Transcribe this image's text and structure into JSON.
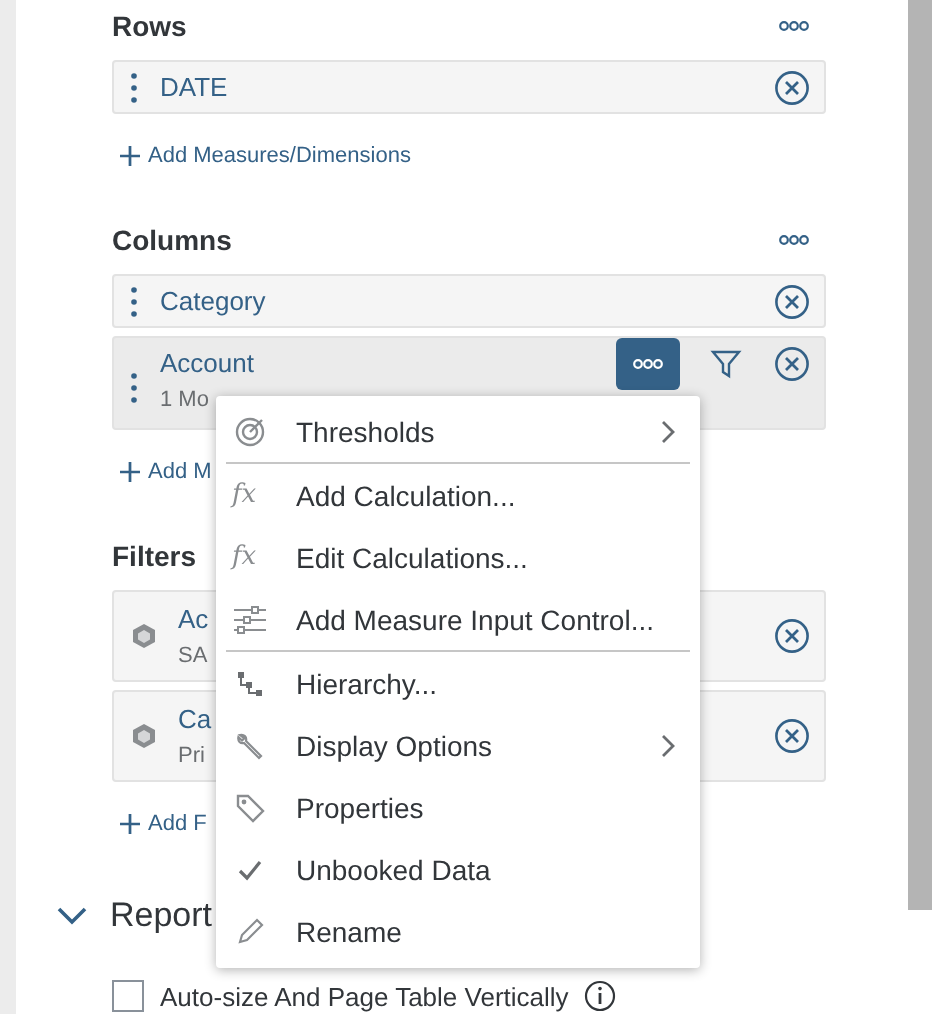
{
  "sections": [
    {
      "title": "Rows",
      "more_button": true,
      "add_label": "Add Measures/Dimensions",
      "items": [
        {
          "kind": "field",
          "name": "DATE",
          "selected": false
        }
      ]
    },
    {
      "title": "Columns",
      "more_button": true,
      "add_label": "Add M",
      "items": [
        {
          "kind": "field",
          "name": "Category",
          "selected": false
        },
        {
          "kind": "field",
          "name": "Account",
          "detail": "1 Mo",
          "selected": true
        }
      ]
    },
    {
      "title": "Filters",
      "more_button": false,
      "add_label": "Add F",
      "items": [
        {
          "kind": "filter",
          "name": "Ac",
          "detail": "SA",
          "selected": false
        },
        {
          "kind": "filter",
          "name": "Ca",
          "detail": "Pri",
          "selected": false
        }
      ]
    }
  ],
  "context_menu": {
    "items": [
      {
        "label": "Thresholds",
        "submenu": true,
        "checked": false,
        "separator_after": true
      },
      {
        "label": "Add Calculation...",
        "icon_text": "fx",
        "submenu": false,
        "checked": false,
        "separator_after": false
      },
      {
        "label": "Edit Calculations...",
        "icon_text": "fx",
        "submenu": false,
        "checked": false,
        "separator_after": false
      },
      {
        "label": "Add Measure Input Control...",
        "submenu": false,
        "checked": false,
        "separator_after": true
      },
      {
        "label": "Hierarchy...",
        "submenu": false,
        "checked": false,
        "separator_after": false
      },
      {
        "label": "Display Options",
        "submenu": true,
        "checked": false,
        "separator_after": false
      },
      {
        "label": "Properties",
        "submenu": false,
        "checked": false,
        "separator_after": false
      },
      {
        "label": "Unbooked Data",
        "submenu": false,
        "checked": true,
        "separator_after": false
      },
      {
        "label": "Rename",
        "submenu": false,
        "checked": false,
        "separator_after": false
      }
    ]
  },
  "report": {
    "title": "Report",
    "expanded": true,
    "options": [
      {
        "label": "Auto-size And Page Table Vertically",
        "checked": false
      }
    ]
  }
}
